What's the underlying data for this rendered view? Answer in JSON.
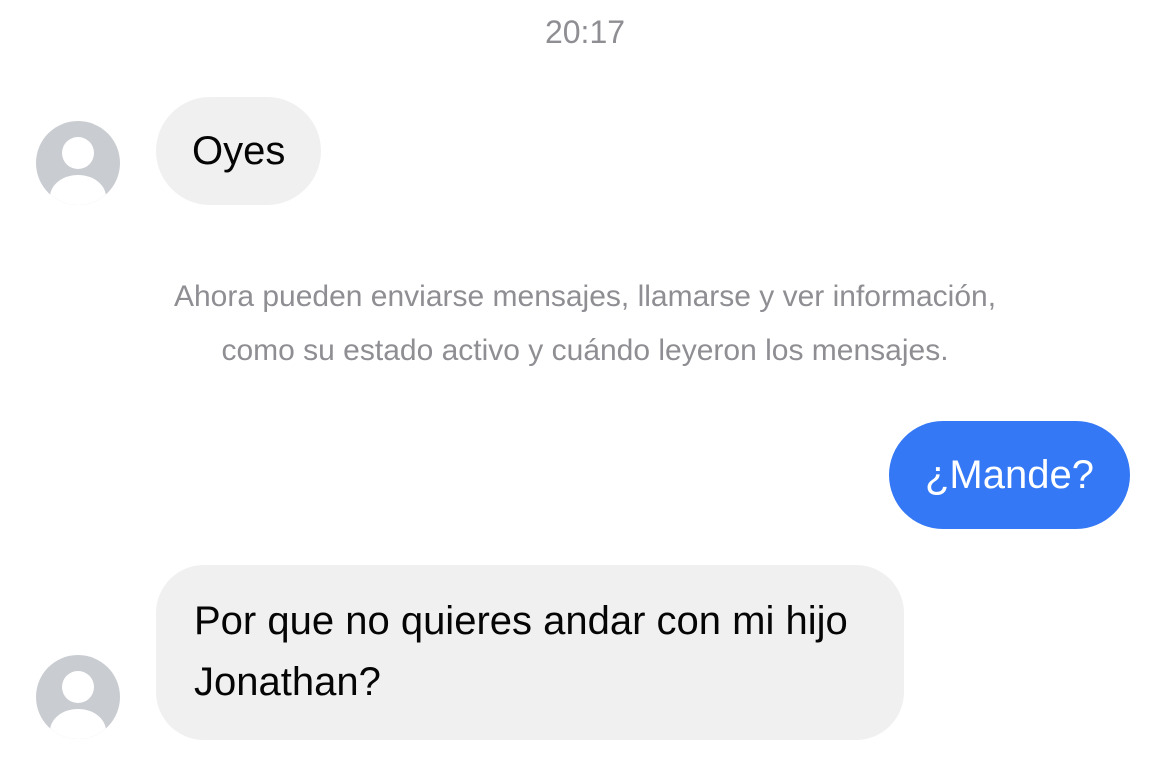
{
  "conversation": {
    "timestamp": "20:17",
    "messages": [
      {
        "direction": "incoming",
        "text": "Oyes",
        "has_avatar": true
      },
      {
        "direction": "outgoing",
        "text": "¿Mande?",
        "has_avatar": false
      },
      {
        "direction": "incoming",
        "text": "Por que no quieres andar con mi hijo Jonathan?",
        "has_avatar": true
      }
    ],
    "system_notice": {
      "line1": "Ahora pueden enviarse mensajes, llamarse y ver información,",
      "line2": "como su estado activo y cuándo leyeron los mensajes."
    }
  },
  "colors": {
    "incoming_bubble": "#f0f0f0",
    "outgoing_bubble": "#3478f6",
    "secondary_text": "#8e8e93",
    "avatar_placeholder": "#c9ccd1"
  },
  "icons": {
    "avatar": "default-user-avatar-icon"
  }
}
